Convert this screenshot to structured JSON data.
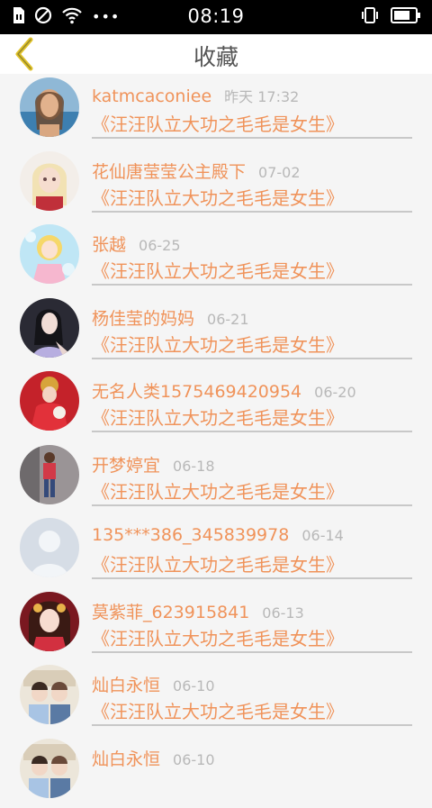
{
  "status_bar": {
    "time": "08:19"
  },
  "header": {
    "title": "收藏"
  },
  "colors": {
    "accent": "#f0935a",
    "back_arrow": "#e0c22a",
    "status_bar_bg": "#000000"
  },
  "favorites": [
    {
      "user": "katmcaconiee",
      "time": "昨天 17:32",
      "work": "《汪汪队立大功之毛毛是女生》",
      "avatar": "avatar-photo-woman-beach"
    },
    {
      "user": "花仙唐莹莹公主殿下",
      "time": "07-02",
      "work": "《汪汪队立大功之毛毛是女生》",
      "avatar": "avatar-anime-girl"
    },
    {
      "user": "张越",
      "time": "06-25",
      "work": "《汪汪队立大功之毛毛是女生》",
      "avatar": "avatar-cartoon-princess"
    },
    {
      "user": "杨佳莹的妈妈",
      "time": "06-21",
      "work": "《汪汪队立大功之毛毛是女生》",
      "avatar": "avatar-photo-woman"
    },
    {
      "user": "无名人类1575469420954",
      "time": "06-20",
      "work": "《汪汪队立大功之毛毛是女生》",
      "avatar": "avatar-photo-red-dress"
    },
    {
      "user": "开梦婷宜",
      "time": "06-18",
      "work": "《汪汪队立大功之毛毛是女生》",
      "avatar": "avatar-photo-child"
    },
    {
      "user": "135***386_345839978",
      "time": "06-14",
      "work": "《汪汪队立大功之毛毛是女生》",
      "avatar": "avatar-default"
    },
    {
      "user": "莫紫菲_623915841",
      "time": "06-13",
      "work": "《汪汪队立大功之毛毛是女生》",
      "avatar": "avatar-anime-red"
    },
    {
      "user": "灿白永恒",
      "time": "06-10",
      "work": "《汪汪队立大功之毛毛是女生》",
      "avatar": "avatar-photo-two-people"
    },
    {
      "user": "灿白永恒",
      "time": "06-10",
      "work": "",
      "avatar": "avatar-photo-two-people"
    }
  ]
}
